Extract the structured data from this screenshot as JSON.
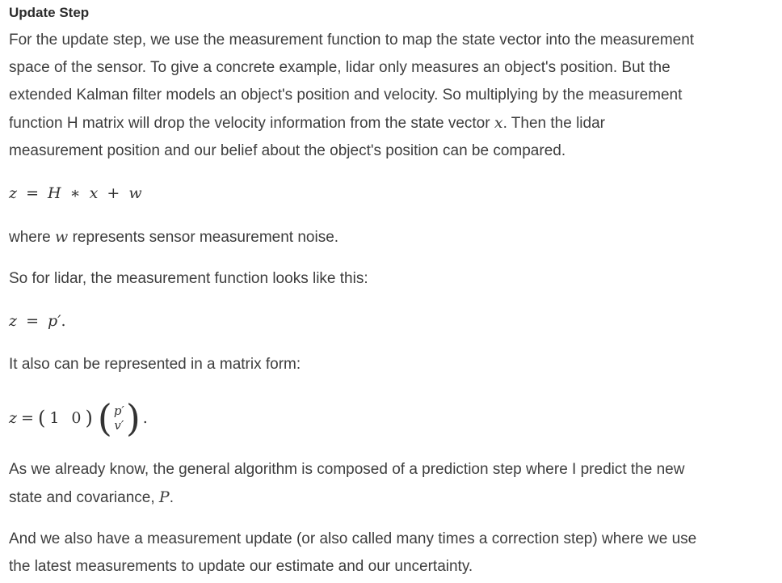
{
  "section": {
    "title": "Update Step"
  },
  "paragraphs": {
    "p1": {
      "line1": "For the update step, we use the measurement function to map the state vector into the measurement",
      "line2": "space of the sensor. To give a concrete example, lidar only measures an object's position. But the",
      "line3": "extended Kalman filter models an object's position and velocity. So multiplying by the measurement",
      "line4_a": "function H matrix will drop the velocity information from the state vector ",
      "line4_math": "x",
      "line4_b": ". Then the lidar",
      "line5": "measurement position and our belief about the object's position can be compared."
    },
    "eq1": {
      "z": "z",
      "eq": "=",
      "H": "H",
      "mul": "∗",
      "x": "x",
      "plus": "+",
      "w": "w"
    },
    "p2": {
      "a": "where ",
      "math": "w",
      "b": " represents sensor measurement noise."
    },
    "p3": {
      "text": "So for lidar, the measurement function looks like this:"
    },
    "eq2": {
      "z": "z",
      "eq": "=",
      "rhs": "p′",
      "dot": "."
    },
    "p4": {
      "text": "It also can be represented in a matrix form:"
    },
    "eq3": {
      "z": "z",
      "eq": "=",
      "row": [
        "1",
        "0"
      ],
      "col": [
        "p′",
        "v′"
      ],
      "dot": "."
    },
    "p5": {
      "line1": "As we already know, the general algorithm is composed of a prediction step where I predict the new",
      "line2_a": "state and covariance, ",
      "line2_math": "P",
      "line2_b": "."
    },
    "p6": {
      "line1": "And we also have a measurement update (or also called many times a correction step) where we use",
      "line2": "the latest measurements to update our estimate and our uncertainty."
    }
  }
}
